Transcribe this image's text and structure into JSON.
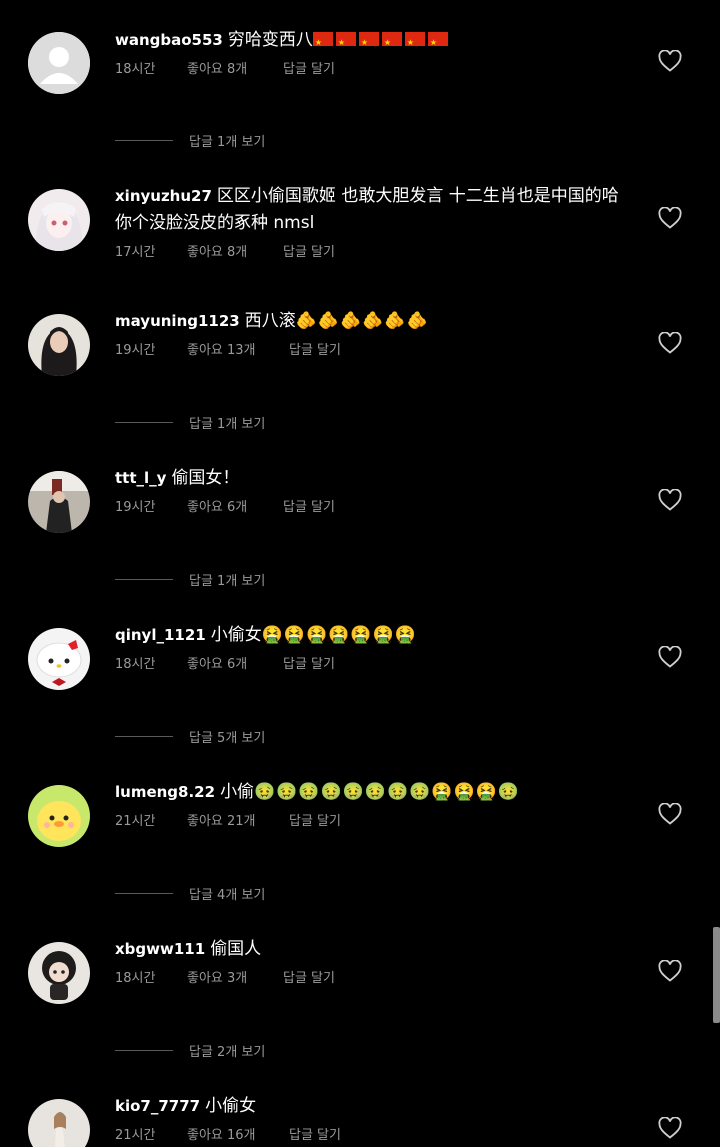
{
  "comments": [
    {
      "username": "wangbao553",
      "text": "穷哈变西八",
      "emoji": "",
      "flags": 6,
      "time": "18시간",
      "likes": "좋아요 8개",
      "reply": "답글 달기",
      "view_replies": "답글 1개 보기",
      "avatar": "default-avatar-icon"
    },
    {
      "username": "xinyuzhu27",
      "text": "区区小偷国歌姬 也敢大胆发言 十二生肖也是中国的哈你个没脸没皮的豖种 nmsl",
      "emoji": "",
      "time": "17시간",
      "likes": "좋아요 8개",
      "reply": "답글 달기",
      "view_replies": "",
      "avatar": "anime-girl-avatar"
    },
    {
      "username": "mayuning1123",
      "text": "西八滚",
      "emoji": "🫵🫵🫵🫵🫵🫵",
      "time": "19시간",
      "likes": "좋아요 13개",
      "reply": "답글 달기",
      "view_replies": "답글 1개 보기",
      "avatar": "woman-photo-avatar"
    },
    {
      "username": "ttt_l_y",
      "text": "偷国女！",
      "emoji": "",
      "time": "19시간",
      "likes": "좋아요 6개",
      "reply": "답글 달기",
      "view_replies": "답글 1개 보기",
      "avatar": "photo-avatar"
    },
    {
      "username": "qinyl_1121",
      "text": "小偷女",
      "emoji": "🤮🤮🤮🤮🤮🤮🤮",
      "time": "18시간",
      "likes": "좋아요 6개",
      "reply": "답글 달기",
      "view_replies": "답글 5개 보기",
      "avatar": "hello-kitty-avatar"
    },
    {
      "username": "lumeng8.22",
      "text": "小偷",
      "emoji": "🤢🤢🤢🤢🤢🤢🤢🤢🤮🤮🤮🤢",
      "time": "21시간",
      "likes": "좋아요 21개",
      "reply": "답글 달기",
      "view_replies": "답글 4개 보기",
      "avatar": "yellow-chick-avatar"
    },
    {
      "username": "xbgww111",
      "text": "偷国人",
      "emoji": "",
      "time": "18시간",
      "likes": "좋아요 3개",
      "reply": "답글 달기",
      "view_replies": "답글 2개 보기",
      "avatar": "doll-avatar"
    },
    {
      "username": "kio7_7777",
      "text": "小偷女",
      "emoji": "",
      "time": "21시간",
      "likes": "좋아요 16개",
      "reply": "답글 달기",
      "view_replies": "",
      "avatar": "figure-avatar"
    }
  ]
}
